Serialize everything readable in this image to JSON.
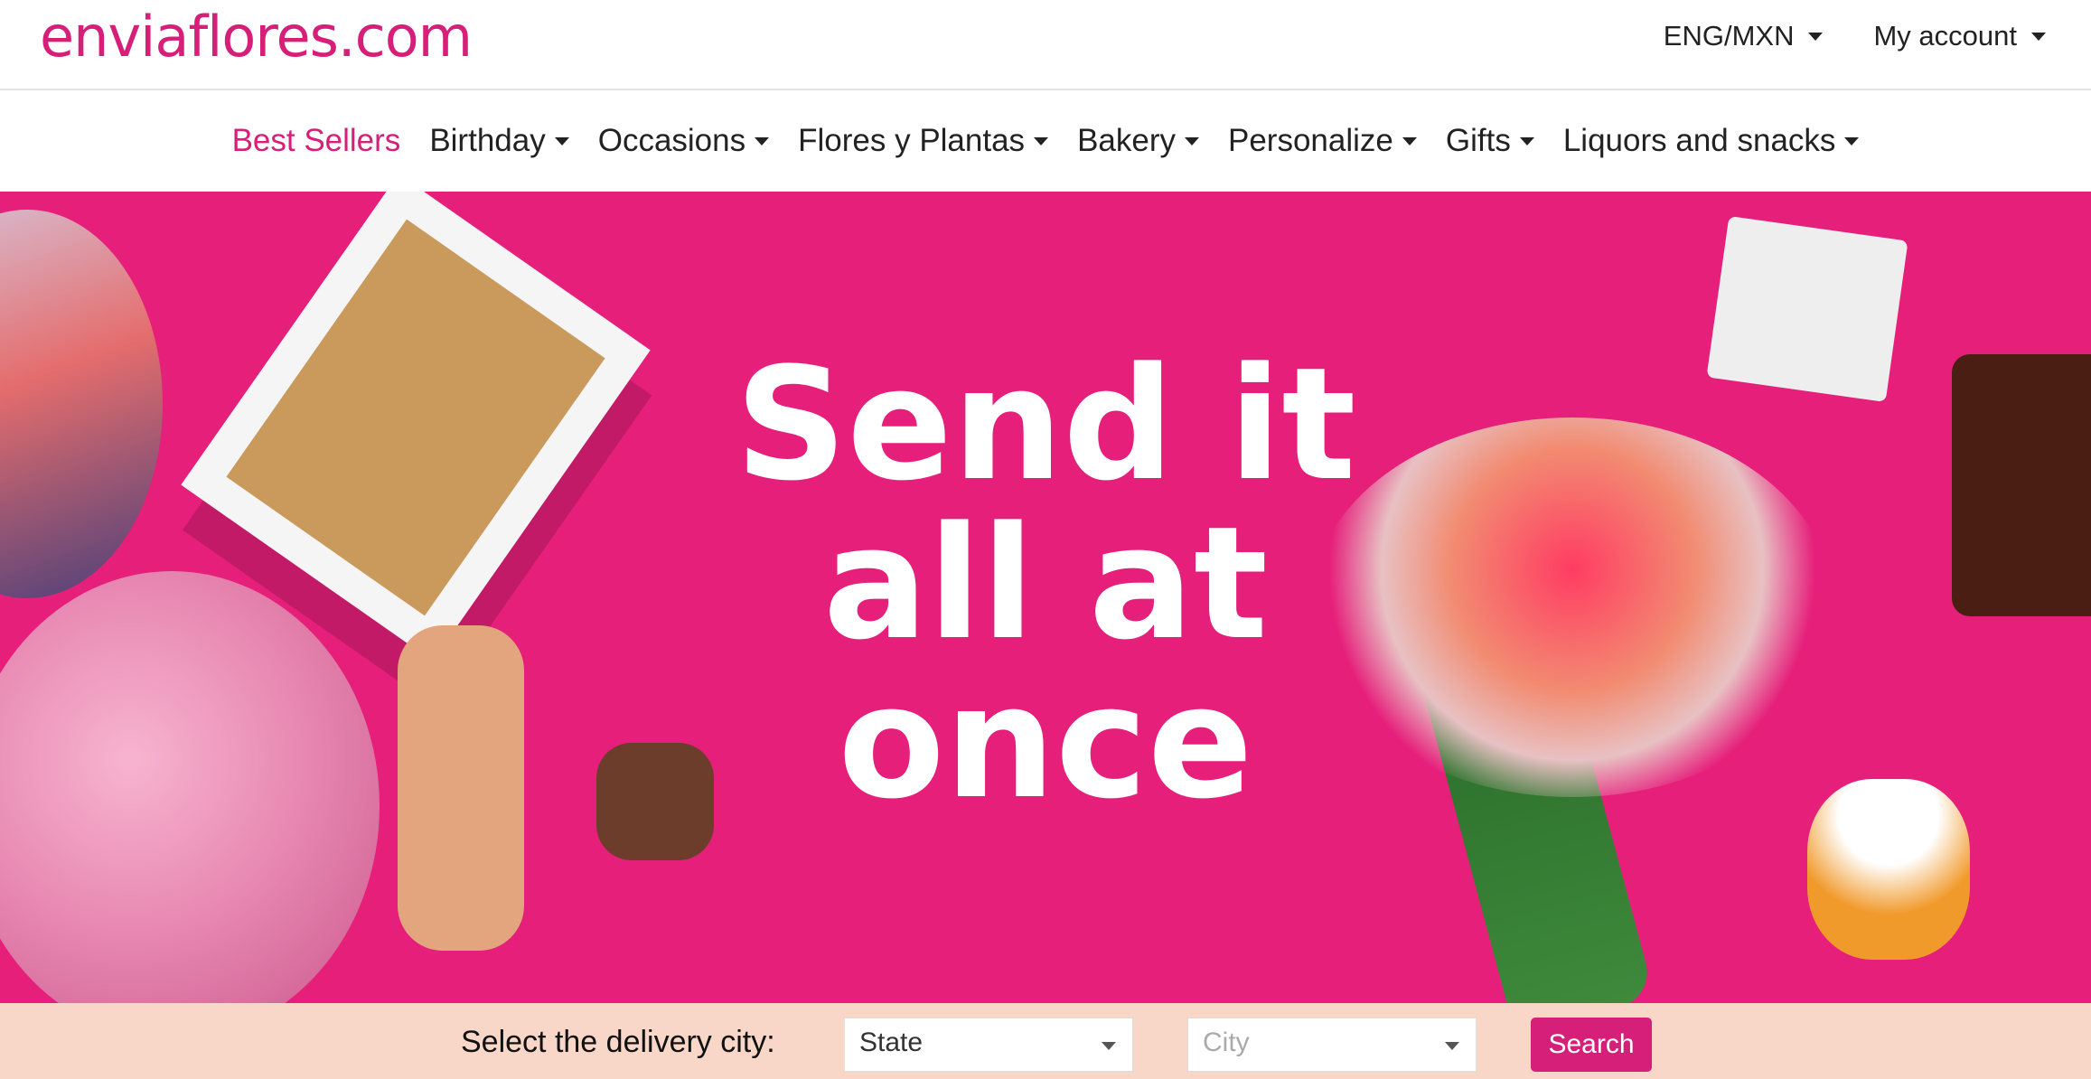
{
  "header": {
    "logo": "enviaflores.com",
    "language_currency": "ENG/MXN",
    "account": "My account"
  },
  "nav": {
    "items": [
      {
        "label": "Best Sellers"
      },
      {
        "label": "Birthday"
      },
      {
        "label": "Occasions"
      },
      {
        "label": "Flores y Plantas"
      },
      {
        "label": "Bakery"
      },
      {
        "label": "Personalize"
      },
      {
        "label": "Gifts"
      },
      {
        "label": "Liquors and snacks"
      }
    ]
  },
  "hero": {
    "line1": "Send it",
    "line2": "all at",
    "line3": "once"
  },
  "delivery": {
    "label": "Select the delivery city:",
    "state_selected": "State",
    "city_placeholder": "City",
    "search_label": "Search"
  },
  "colors": {
    "brand": "#d61f78",
    "hero_bg": "#e61f7b",
    "search_bar_bg": "#f8d6c8"
  }
}
